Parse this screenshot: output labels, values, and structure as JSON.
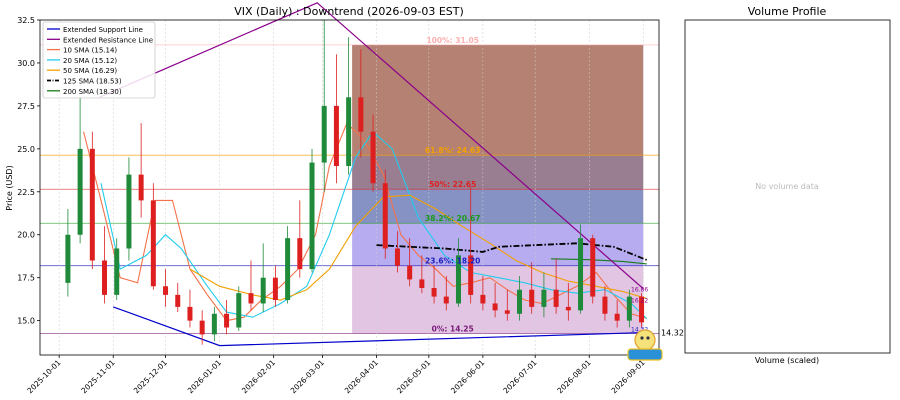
{
  "chart_data": [
    {
      "type": "candlestick",
      "title": "VIX (Daily) : Downtrend (2026-09-03 EST)",
      "ylabel": "Price (USD)",
      "ylim": [
        13.0,
        32.5
      ],
      "xlim": [
        "2025-09-20",
        "2026-09-10"
      ],
      "y_ticks": [
        15.0,
        17.5,
        20.0,
        22.5,
        25.0,
        27.5,
        30.0,
        32.5
      ],
      "y_tick_labels": [
        "15.0",
        "17.5",
        "20.0",
        "22.5",
        "25.0",
        "27.5",
        "30.0",
        "32.5"
      ],
      "x_ticks": [
        "2025-10-01",
        "2025-11-01",
        "2025-12-01",
        "2026-01-01",
        "2026-02-01",
        "2026-03-01",
        "2026-04-01",
        "2026-05-01",
        "2026-06-01",
        "2026-07-01",
        "2026-08-01",
        "2026-09-01"
      ],
      "legend_position": "top-left",
      "legend": [
        {
          "name": "Extended Support Line",
          "color": "#0000cc",
          "style": "solid"
        },
        {
          "name": "Extended Resistance Line",
          "color": "#8b008b",
          "style": "solid"
        },
        {
          "name": "10 SMA (15.14)",
          "color": "#f4724a",
          "style": "solid"
        },
        {
          "name": "20 SMA (15.12)",
          "color": "#22ccee",
          "style": "solid"
        },
        {
          "name": "50 SMA (16.29)",
          "color": "#f4a000",
          "style": "solid"
        },
        {
          "name": "125 SMA (18.53)",
          "color": "#000000",
          "style": "dashdot"
        },
        {
          "name": "200 SMA (18.30)",
          "color": "#1a7a1a",
          "style": "solid"
        }
      ],
      "fib_box": {
        "start": "2026-03-18",
        "end": "2026-09-01"
      },
      "fib_levels": [
        {
          "label": "100%: 31.05",
          "value": 31.05,
          "color": "#ffb0b0",
          "band_color": "#b07a6a"
        },
        {
          "label": "61.8%: 24.63",
          "value": 24.63,
          "color": "#f4a000",
          "band_color": "#94768a"
        },
        {
          "label": "50%: 22.65",
          "value": 22.65,
          "color": "#e02020",
          "band_color": "#7f8cc0"
        },
        {
          "label": "38.2%: 20.67",
          "value": 20.67,
          "color": "#1a9a1a",
          "band_color": "#b3a8ee"
        },
        {
          "label": "23.6%: 18.20",
          "value": 18.2,
          "color": "#2020c0",
          "band_color": "#dfc2e2"
        },
        {
          "label": "0%: 14.25",
          "value": 14.25,
          "color": "#7a1a7a"
        }
      ],
      "support_line": {
        "points": [
          [
            "2025-11-01",
            15.8
          ],
          [
            "2026-01-01",
            13.55
          ],
          [
            "2026-09-06",
            14.32
          ]
        ],
        "label": "14.32"
      },
      "resistance_line": {
        "points": [
          [
            "2025-10-24",
            28.0
          ],
          [
            "2026-02-26",
            33.5
          ],
          [
            "2026-09-01",
            16.86
          ]
        ],
        "label": "16.86"
      },
      "end_labels": [
        {
          "text": "16.86",
          "value": 16.86,
          "color": "#8b008b"
        },
        {
          "text": "16.22",
          "value": 16.22,
          "color": "#8b008b"
        },
        {
          "text": "14.32",
          "value": 14.55,
          "color": "#2020c0"
        }
      ],
      "sma_series": [
        {
          "name": "10 SMA",
          "color": "#f4724a",
          "points": [
            [
              "2025-10-15",
              26.0
            ],
            [
              "2025-10-25",
              22.0
            ],
            [
              "2025-11-05",
              17.5
            ],
            [
              "2025-11-15",
              17.2
            ],
            [
              "2025-11-25",
              22.0
            ],
            [
              "2025-12-05",
              22.0
            ],
            [
              "2025-12-15",
              18.0
            ],
            [
              "2025-12-25",
              16.5
            ],
            [
              "2026-01-05",
              15.0
            ],
            [
              "2026-01-15",
              15.2
            ],
            [
              "2026-01-25",
              16.2
            ],
            [
              "2026-02-05",
              17.0
            ],
            [
              "2026-02-15",
              18.0
            ],
            [
              "2026-02-25",
              20.0
            ],
            [
              "2026-03-05",
              24.0
            ],
            [
              "2026-03-15",
              26.5
            ],
            [
              "2026-03-25",
              25.5
            ],
            [
              "2026-04-05",
              23.5
            ],
            [
              "2026-04-15",
              20.0
            ],
            [
              "2026-04-25",
              18.8
            ],
            [
              "2026-05-05",
              18.0
            ],
            [
              "2026-05-15",
              17.0
            ],
            [
              "2026-05-25",
              17.2
            ],
            [
              "2026-06-05",
              17.5
            ],
            [
              "2026-06-15",
              16.8
            ],
            [
              "2026-06-25",
              16.2
            ],
            [
              "2026-07-05",
              16.0
            ],
            [
              "2026-07-15",
              16.5
            ],
            [
              "2026-07-25",
              17.0
            ],
            [
              "2026-08-05",
              17.8
            ],
            [
              "2026-08-15",
              16.5
            ],
            [
              "2026-08-25",
              15.4
            ],
            [
              "2026-09-03",
              15.14
            ]
          ]
        },
        {
          "name": "20 SMA",
          "color": "#22ccee",
          "points": [
            [
              "2025-10-25",
              23.0
            ],
            [
              "2025-11-05",
              18.0
            ],
            [
              "2025-11-20",
              18.8
            ],
            [
              "2025-12-01",
              20.0
            ],
            [
              "2025-12-10",
              19.2
            ],
            [
              "2025-12-25",
              17.0
            ],
            [
              "2026-01-05",
              15.5
            ],
            [
              "2026-01-20",
              15.2
            ],
            [
              "2026-02-05",
              16.0
            ],
            [
              "2026-02-20",
              17.0
            ],
            [
              "2026-03-05",
              20.0
            ],
            [
              "2026-03-20",
              24.5
            ],
            [
              "2026-03-30",
              26.0
            ],
            [
              "2026-04-10",
              25.0
            ],
            [
              "2026-04-25",
              21.0
            ],
            [
              "2026-05-10",
              18.8
            ],
            [
              "2026-05-25",
              17.8
            ],
            [
              "2026-06-10",
              17.5
            ],
            [
              "2026-06-25",
              17.2
            ],
            [
              "2026-07-10",
              16.8
            ],
            [
              "2026-07-25",
              16.6
            ],
            [
              "2026-08-10",
              16.8
            ],
            [
              "2026-08-25",
              16.0
            ],
            [
              "2026-09-03",
              15.12
            ]
          ]
        },
        {
          "name": "50 SMA",
          "color": "#f4a000",
          "points": [
            [
              "2025-12-15",
              18.0
            ],
            [
              "2026-01-01",
              17.0
            ],
            [
              "2026-01-20",
              16.5
            ],
            [
              "2026-02-05",
              16.2
            ],
            [
              "2026-02-20",
              16.8
            ],
            [
              "2026-03-05",
              18.0
            ],
            [
              "2026-03-20",
              20.5
            ],
            [
              "2026-04-05",
              22.2
            ],
            [
              "2026-04-20",
              22.3
            ],
            [
              "2026-05-05",
              21.5
            ],
            [
              "2026-05-20",
              20.5
            ],
            [
              "2026-06-05",
              19.5
            ],
            [
              "2026-06-20",
              18.5
            ],
            [
              "2026-07-05",
              17.8
            ],
            [
              "2026-07-20",
              17.3
            ],
            [
              "2026-08-05",
              17.0
            ],
            [
              "2026-08-20",
              16.7
            ],
            [
              "2026-09-03",
              16.29
            ]
          ]
        },
        {
          "name": "125 SMA",
          "color": "#000000",
          "dash": true,
          "points": [
            [
              "2026-04-01",
              19.4
            ],
            [
              "2026-04-20",
              19.3
            ],
            [
              "2026-05-10",
              19.2
            ],
            [
              "2026-06-01",
              19.0
            ],
            [
              "2026-06-10",
              19.3
            ],
            [
              "2026-07-01",
              19.4
            ],
            [
              "2026-07-25",
              19.5
            ],
            [
              "2026-08-15",
              19.3
            ],
            [
              "2026-09-03",
              18.53
            ]
          ]
        },
        {
          "name": "200 SMA",
          "color": "#1a7a1a",
          "points": [
            [
              "2026-07-10",
              18.6
            ],
            [
              "2026-08-01",
              18.55
            ],
            [
              "2026-08-20",
              18.45
            ],
            [
              "2026-09-03",
              18.3
            ]
          ]
        }
      ],
      "candles": [
        [
          "2025-10-06",
          17.2,
          21.5,
          16.4,
          20.0
        ],
        [
          "2025-10-13",
          20.0,
          28.0,
          19.5,
          25.0
        ],
        [
          "2025-10-20",
          25.0,
          26.0,
          18.0,
          18.5
        ],
        [
          "2025-10-27",
          18.5,
          20.5,
          16.0,
          16.5
        ],
        [
          "2025-11-03",
          16.5,
          19.8,
          16.2,
          19.2
        ],
        [
          "2025-11-10",
          19.2,
          24.5,
          18.5,
          23.5
        ],
        [
          "2025-11-17",
          23.5,
          26.5,
          21.0,
          22.0
        ],
        [
          "2025-11-24",
          22.0,
          23.0,
          16.8,
          17.0
        ],
        [
          "2025-12-01",
          17.0,
          18.0,
          15.8,
          16.5
        ],
        [
          "2025-12-08",
          16.5,
          17.2,
          15.5,
          15.8
        ],
        [
          "2025-12-15",
          15.8,
          16.8,
          14.6,
          15.0
        ],
        [
          "2025-12-22",
          15.0,
          15.6,
          13.6,
          14.2
        ],
        [
          "2025-12-29",
          14.2,
          15.8,
          13.8,
          15.4
        ],
        [
          "2026-01-05",
          15.4,
          16.2,
          14.2,
          14.6
        ],
        [
          "2026-01-12",
          14.6,
          17.0,
          14.4,
          16.6
        ],
        [
          "2026-01-19",
          16.6,
          18.5,
          15.6,
          16.0
        ],
        [
          "2026-01-26",
          16.0,
          19.5,
          15.5,
          17.5
        ],
        [
          "2026-02-02",
          17.5,
          18.2,
          15.8,
          16.2
        ],
        [
          "2026-02-09",
          16.2,
          20.5,
          16.0,
          19.8
        ],
        [
          "2026-02-16",
          19.8,
          22.0,
          17.5,
          18.0
        ],
        [
          "2026-02-23",
          18.0,
          25.0,
          17.8,
          24.2
        ],
        [
          "2026-03-02",
          24.2,
          32.5,
          22.5,
          27.5
        ],
        [
          "2026-03-09",
          27.5,
          30.5,
          23.0,
          24.0
        ],
        [
          "2026-03-16",
          24.0,
          31.5,
          23.5,
          28.0
        ],
        [
          "2026-03-23",
          28.0,
          30.8,
          24.5,
          26.0
        ],
        [
          "2026-03-30",
          26.0,
          27.0,
          22.5,
          23.0
        ],
        [
          "2026-04-06",
          23.0,
          23.8,
          18.6,
          19.2
        ],
        [
          "2026-04-13",
          19.2,
          20.2,
          17.8,
          18.2
        ],
        [
          "2026-04-20",
          18.2,
          19.8,
          17.0,
          17.4
        ],
        [
          "2026-04-27",
          17.4,
          18.8,
          16.6,
          16.9
        ],
        [
          "2026-05-04",
          16.9,
          18.2,
          16.0,
          16.4
        ],
        [
          "2026-05-11",
          16.4,
          17.6,
          15.6,
          16.0
        ],
        [
          "2026-05-18",
          16.0,
          19.8,
          15.8,
          18.8
        ],
        [
          "2026-05-25",
          18.8,
          22.8,
          16.0,
          16.5
        ],
        [
          "2026-06-01",
          16.5,
          17.6,
          15.6,
          16.0
        ],
        [
          "2026-06-08",
          16.0,
          17.2,
          15.2,
          15.6
        ],
        [
          "2026-06-15",
          15.6,
          16.8,
          15.0,
          15.4
        ],
        [
          "2026-06-22",
          15.4,
          17.6,
          15.0,
          16.8
        ],
        [
          "2026-06-29",
          16.8,
          18.4,
          15.4,
          15.8
        ],
        [
          "2026-07-06",
          15.8,
          17.8,
          15.2,
          16.8
        ],
        [
          "2026-07-13",
          16.8,
          18.6,
          15.4,
          15.8
        ],
        [
          "2026-07-20",
          15.8,
          17.2,
          15.0,
          15.6
        ],
        [
          "2026-07-27",
          15.6,
          20.6,
          15.4,
          19.8
        ],
        [
          "2026-08-03",
          19.8,
          20.0,
          16.0,
          16.4
        ],
        [
          "2026-08-10",
          16.4,
          17.0,
          15.0,
          15.4
        ],
        [
          "2026-08-17",
          15.4,
          16.2,
          14.6,
          15.0
        ],
        [
          "2026-08-24",
          15.0,
          16.8,
          14.6,
          16.4
        ],
        [
          "2026-08-31",
          16.4,
          16.6,
          14.6,
          14.9
        ]
      ]
    },
    {
      "type": "bar",
      "title": "Volume Profile",
      "xlabel": "Volume (scaled)",
      "empty_message": "No volume data",
      "values": []
    }
  ]
}
